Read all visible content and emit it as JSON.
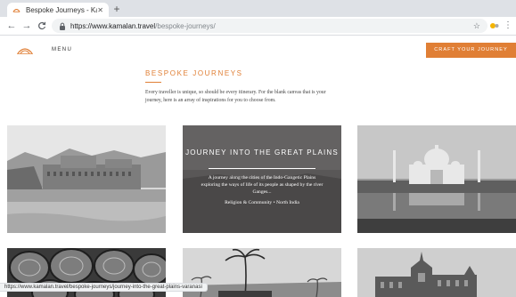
{
  "browser": {
    "tab_title": "Bespoke Journeys - Kamalan",
    "tab_close": "✕",
    "new_tab": "+",
    "url_host": "https://www.kamalan.travel",
    "url_path": "/bespoke-journeys/",
    "back": "←",
    "forward": "→",
    "reload": "C",
    "star": "☆",
    "menu": "⋮"
  },
  "site": {
    "menu_label": "MENU",
    "cta_label": "CRAFT YOUR JOURNEY",
    "heading": "BESPOKE JOURNEYS",
    "intro": "Every traveller is unique, so should be every itinerary. For the blank canvas that is your journey, here is an array of inspirations for you to choose from."
  },
  "featured_journey": {
    "title": "JOURNEY INTO THE GREAT PLAINS",
    "description": "A journey along the cities of the Indo-Gangetic Plains exploring the ways of life of its people as shaped by the river Ganges...",
    "meta": "Religion & Community • North India"
  },
  "status_url": "https://www.kamalan.travel/bespoke-journeys/journey-into-the-great-plains-varanasi",
  "colors": {
    "accent": "#e07f35"
  }
}
